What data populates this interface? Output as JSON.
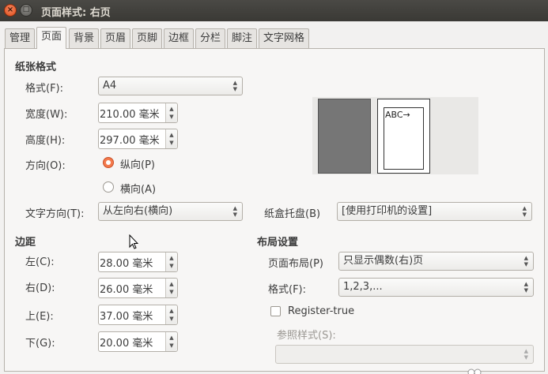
{
  "window": {
    "title": "页面样式: 右页"
  },
  "tabs": [
    {
      "label": "管理"
    },
    {
      "label": "页面"
    },
    {
      "label": "背景"
    },
    {
      "label": "页眉"
    },
    {
      "label": "页脚"
    },
    {
      "label": "边框"
    },
    {
      "label": "分栏"
    },
    {
      "label": "脚注"
    },
    {
      "label": "文字网格"
    }
  ],
  "active_tab": "页面",
  "paper_format": {
    "section_title": "纸张格式",
    "format_label": "格式(F):",
    "format_value": "A4",
    "width_label": "宽度(W):",
    "width_value": "210.00 毫米",
    "height_label": "高度(H):",
    "height_value": "297.00 毫米",
    "orientation_label": "方向(O):",
    "portrait_label": "纵向(P)",
    "landscape_label": "横向(A)",
    "text_direction_label": "文字方向(T):",
    "text_direction_value": "从左向右(横向)",
    "paper_tray_label": "纸盒托盘(B)",
    "paper_tray_value": "[使用打印机的设置]"
  },
  "preview": {
    "sample_text": "ABC→"
  },
  "margins": {
    "section_title": "边距",
    "left_label": "左(C):",
    "left_value": "28.00 毫米",
    "right_label": "右(D):",
    "right_value": "26.00 毫米",
    "top_label": "上(E):",
    "top_value": "37.00 毫米",
    "bottom_label": "下(G):",
    "bottom_value": "20.00 毫米"
  },
  "layout": {
    "section_title": "布局设置",
    "page_layout_label": "页面布局(P)",
    "page_layout_value": "只显示偶数(右)页",
    "format_label": "格式(F):",
    "format_value": "1,2,3,...",
    "register_true_label": "Register-true",
    "reference_style_label": "参照样式(S):",
    "reference_style_value": ""
  },
  "colors": {
    "accent": "#f47a4c",
    "titlebar": "#3c3b37",
    "close_button": "#df4a16"
  }
}
